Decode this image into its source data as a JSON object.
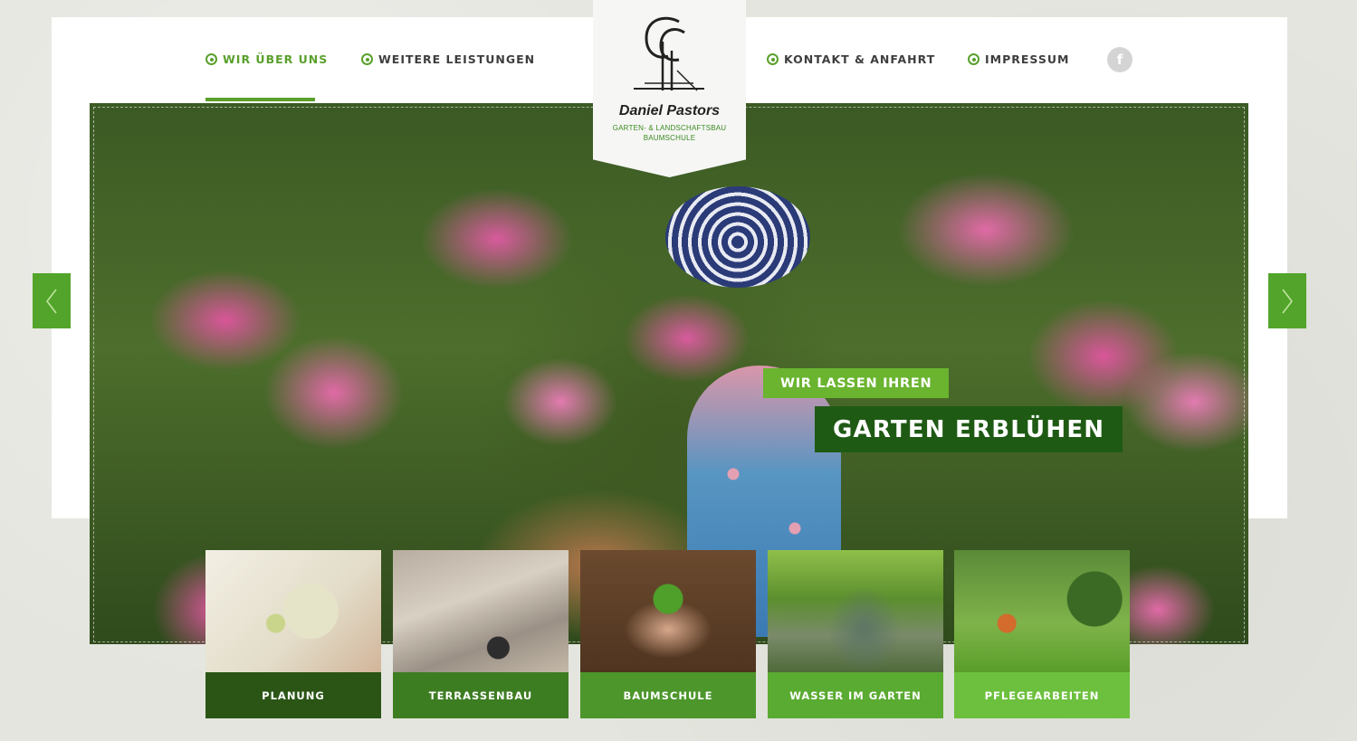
{
  "nav": {
    "items": [
      {
        "label": "WIR ÜBER UNS",
        "active": true
      },
      {
        "label": "WEITERE LEISTUNGEN",
        "active": false
      },
      {
        "label": "KONTAKT & ANFAHRT",
        "active": false
      },
      {
        "label": "IMPRESSUM",
        "active": false
      }
    ],
    "social_icon": "facebook-icon",
    "social_glyph": "f"
  },
  "logo": {
    "name": "Daniel Pastors",
    "line1": "GARTEN- & LANDSCHAFTSBAU",
    "line2": "BAUMSCHULE"
  },
  "slider": {
    "tagline_small": "WIR LASSEN IHREN",
    "tagline_large": "GARTEN ERBLÜHEN",
    "prev_icon": "chevron-left-icon",
    "next_icon": "chevron-right-icon"
  },
  "services": [
    {
      "label": "PLANUNG",
      "color": "#2a5515"
    },
    {
      "label": "TERRASSENBAU",
      "color": "#3d7d22"
    },
    {
      "label": "BAUMSCHULE",
      "color": "#4c962b"
    },
    {
      "label": "WASSER IM GARTEN",
      "color": "#5aab31"
    },
    {
      "label": "PFLEGEARBEITEN",
      "color": "#6cc03d"
    }
  ],
  "colors": {
    "accent": "#5aa02c",
    "dark_green": "#1f5a14",
    "light_green": "#6ab42f",
    "background": "#e4e5de"
  }
}
